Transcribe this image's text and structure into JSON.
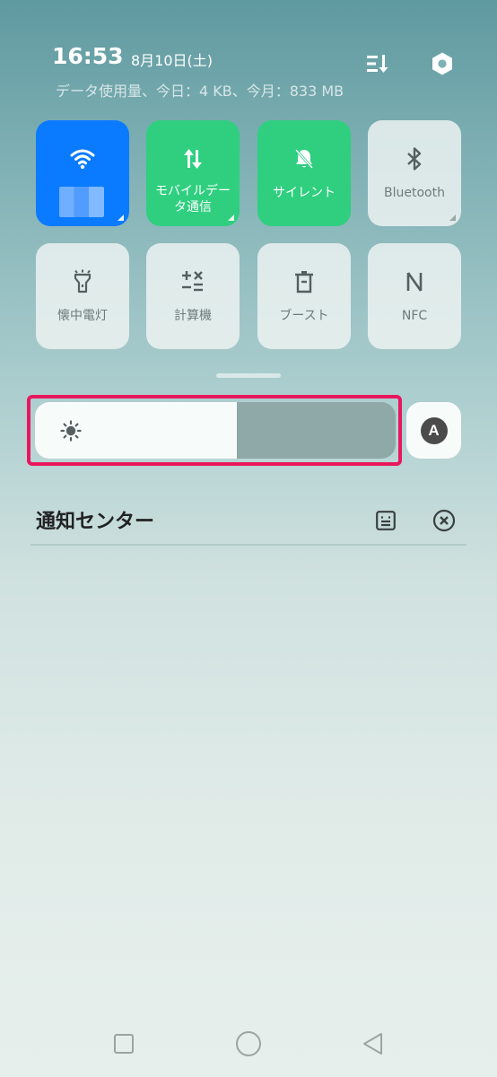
{
  "header": {
    "time": "16:53",
    "date": "8月10日(土)",
    "usage": "データ使用量、今日：4 KB、今月：833 MB"
  },
  "tiles": [
    {
      "label": "",
      "icon": "wifi-icon",
      "state": "on",
      "color": "#0a7bff"
    },
    {
      "label": "モバイルデータ通信",
      "icon": "mobile-data-icon",
      "state": "on",
      "color": "#2fcf7f"
    },
    {
      "label": "サイレント",
      "icon": "bell-off-icon",
      "state": "on",
      "color": "#2fcf7f"
    },
    {
      "label": "Bluetooth",
      "icon": "bluetooth-icon",
      "state": "off"
    },
    {
      "label": "懐中電灯",
      "icon": "flashlight-icon",
      "state": "off"
    },
    {
      "label": "計算機",
      "icon": "calculator-icon",
      "state": "off"
    },
    {
      "label": "ブースト",
      "icon": "trash-icon",
      "state": "off"
    },
    {
      "label": "NFC",
      "icon": "nfc-icon",
      "state": "off"
    }
  ],
  "brightness": {
    "level_percent": 56,
    "auto_label": "A",
    "icon": "sun-icon",
    "highlight_color": "#e8175d"
  },
  "notification_center": {
    "title": "通知センター",
    "manage_icon": "notification-manage-icon",
    "clear_icon": "clear-all-icon"
  },
  "nav": {
    "recent_icon": "square-icon",
    "home_icon": "circle-icon",
    "back_icon": "triangle-back-icon"
  }
}
